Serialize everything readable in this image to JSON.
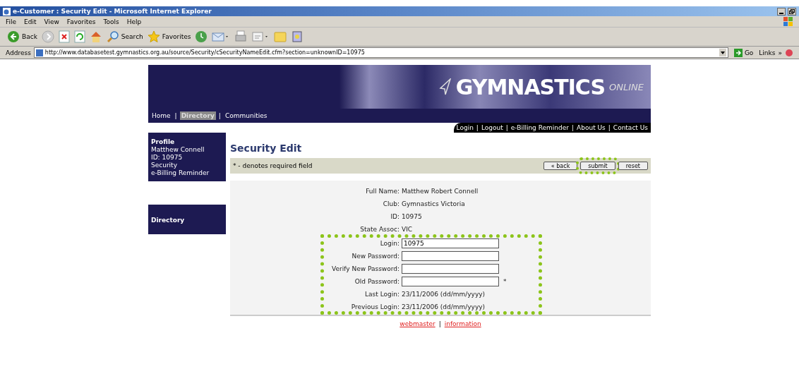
{
  "window": {
    "title": "e-Customer : Security Edit - Microsoft Internet Explorer"
  },
  "menu": [
    "File",
    "Edit",
    "View",
    "Favorites",
    "Tools",
    "Help"
  ],
  "toolbar": [
    {
      "kind": "back",
      "label": "Back"
    },
    {
      "kind": "forward"
    },
    {
      "kind": "stop"
    },
    {
      "kind": "refresh"
    },
    {
      "kind": "home"
    },
    {
      "kind": "search",
      "label": "Search"
    },
    {
      "kind": "favorites",
      "label": "Favorites"
    },
    {
      "kind": "history"
    },
    {
      "kind": "mail"
    },
    {
      "kind": "print"
    },
    {
      "kind": "edit"
    },
    {
      "kind": "folder"
    },
    {
      "kind": "messenger"
    }
  ],
  "address": {
    "label": "Address",
    "url": "http://www.databasetest.gymnastics.org.au/source/Security/cSecurityNameEdit.cfm?section=unknownID=10975",
    "go": "Go",
    "links": "Links",
    "more": "»"
  },
  "site": {
    "logo": "GYMNASTICS",
    "logo_suffix": "ONLINE",
    "separator": "|",
    "nav": [
      {
        "label": "Home",
        "selected": false
      },
      {
        "label": "Directory",
        "selected": true
      },
      {
        "label": "Communities",
        "selected": false
      }
    ],
    "top_links": [
      "Login",
      "Logout",
      "e-Billing Reminder",
      "About Us",
      "Contact Us"
    ],
    "sidebar": [
      {
        "title": "Profile",
        "items": [
          "Matthew Connell",
          "ID: 10975",
          "Security",
          "e-Billing Reminder"
        ]
      },
      {
        "title": "Directory"
      }
    ],
    "page_title": "Security Edit",
    "required_note": "* - denotes required field",
    "buttons": [
      {
        "label": "« back",
        "highlighted": false
      },
      {
        "label": "submit",
        "highlighted": true
      },
      {
        "label": "reset",
        "highlighted": false
      }
    ],
    "sections": [
      {
        "highlighted": false,
        "rows": [
          {
            "kind": "text",
            "label": "Full Name:",
            "value": "Matthew Robert Connell"
          },
          {
            "kind": "text",
            "label": "Club:",
            "value": "Gymnastics Victoria"
          },
          {
            "kind": "text",
            "label": "ID:",
            "value": "10975"
          },
          {
            "kind": "text",
            "label": "State Assoc:",
            "value": "VIC"
          }
        ]
      },
      {
        "highlighted": true,
        "rows": [
          {
            "kind": "input",
            "label": "Login:",
            "value": "10975",
            "required": false
          },
          {
            "kind": "input",
            "label": "New Password:",
            "value": "",
            "required": false
          },
          {
            "kind": "input",
            "label": "Verify New Password:",
            "value": "",
            "required": false
          },
          {
            "kind": "input",
            "label": "Old Password:",
            "value": "",
            "required": true,
            "mark": "*"
          },
          {
            "kind": "text",
            "label": "Last Login:",
            "value": "23/11/2006 (dd/mm/yyyy)"
          },
          {
            "kind": "text",
            "label": "Previous Login:",
            "value": "23/11/2006 (dd/mm/yyyy)"
          }
        ]
      }
    ],
    "footer": [
      "webmaster",
      "information"
    ]
  }
}
